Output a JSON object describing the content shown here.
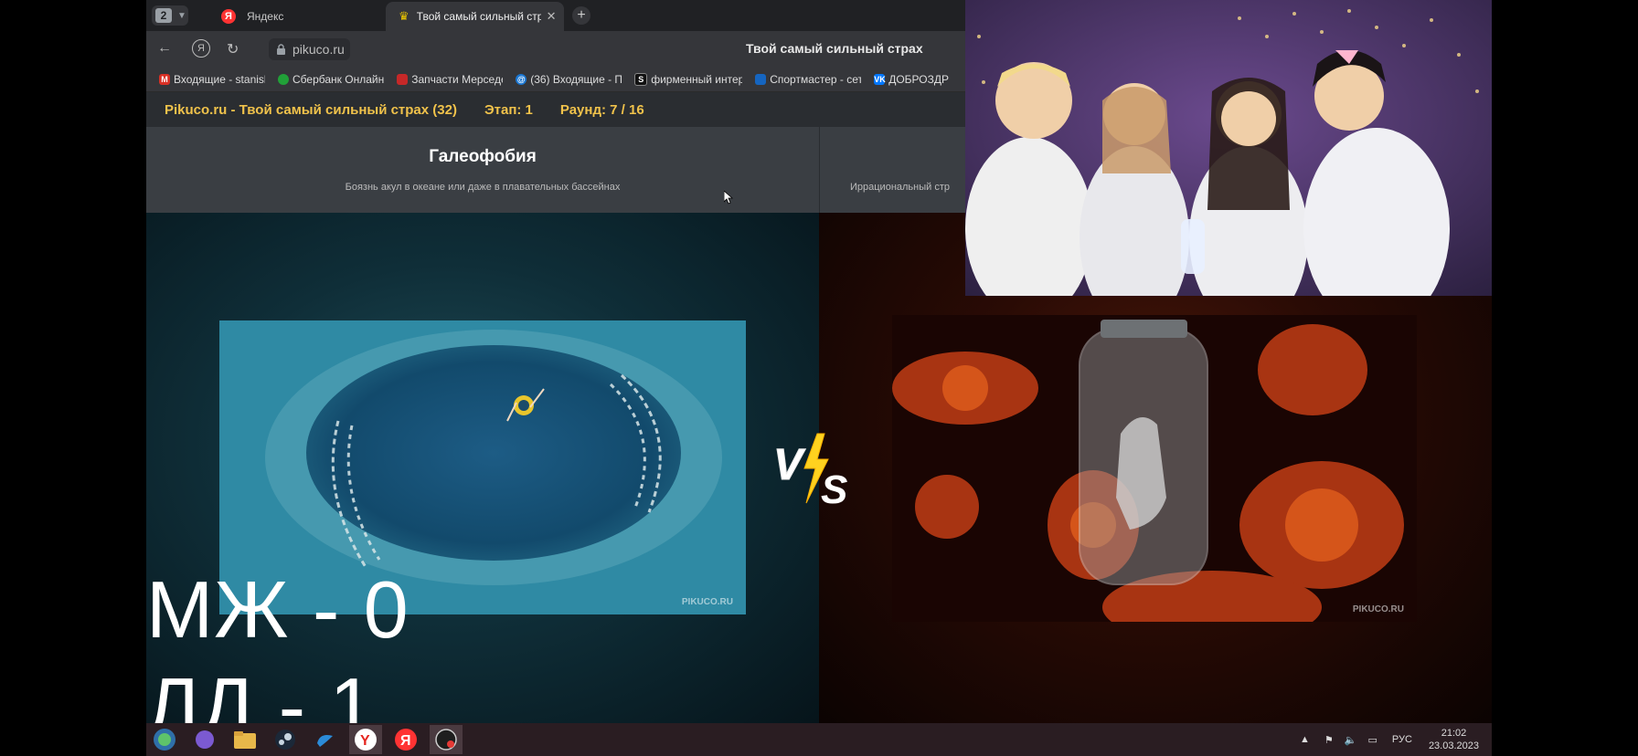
{
  "browser": {
    "tab_count": "2",
    "tabs": [
      {
        "title": "Яндекс",
        "favicon": "yandex-icon"
      },
      {
        "title": "Твой самый сильный страх",
        "favicon": "crown-icon"
      }
    ],
    "url": "pikuco.ru",
    "page_title": "Твой самый сильный страх",
    "bookmarks": [
      {
        "label": "Входящие - stanisl",
        "icon": "gmail-icon",
        "color": "#d93025"
      },
      {
        "label": "Сбербанк Онлайн",
        "icon": "sber-icon",
        "color": "#21a038"
      },
      {
        "label": "Запчасти Мерседе",
        "icon": "parts-icon",
        "color": "#c62828"
      },
      {
        "label": "(36) Входящие - П",
        "icon": "mail-icon",
        "color": "#1976d2"
      },
      {
        "label": "фирменный интер",
        "icon": "s-icon",
        "color": "#222222"
      },
      {
        "label": "Спортмастер - сет",
        "icon": "sport-icon",
        "color": "#1565c0"
      },
      {
        "label": "ДОБРОЗДР",
        "icon": "vk-icon",
        "color": "#0077ff"
      }
    ]
  },
  "site": {
    "heading": "Pikuco.ru - Твой самый сильный страх (32)",
    "stage": "Этап: 1",
    "round": "Раунд: 7 / 16",
    "left": {
      "name": "Галеофобия",
      "description": "Боязнь акул в океане или даже в плавательных бассейнах"
    },
    "right": {
      "description": "Иррациональный стр"
    },
    "watermark": "PIKUCO.RU"
  },
  "overlay": {
    "score_mzh": "МЖ - 0",
    "score_ld": "ЛД - 1"
  },
  "taskbar": {
    "language": "РУС",
    "time": "21:02",
    "date": "23.03.2023"
  }
}
